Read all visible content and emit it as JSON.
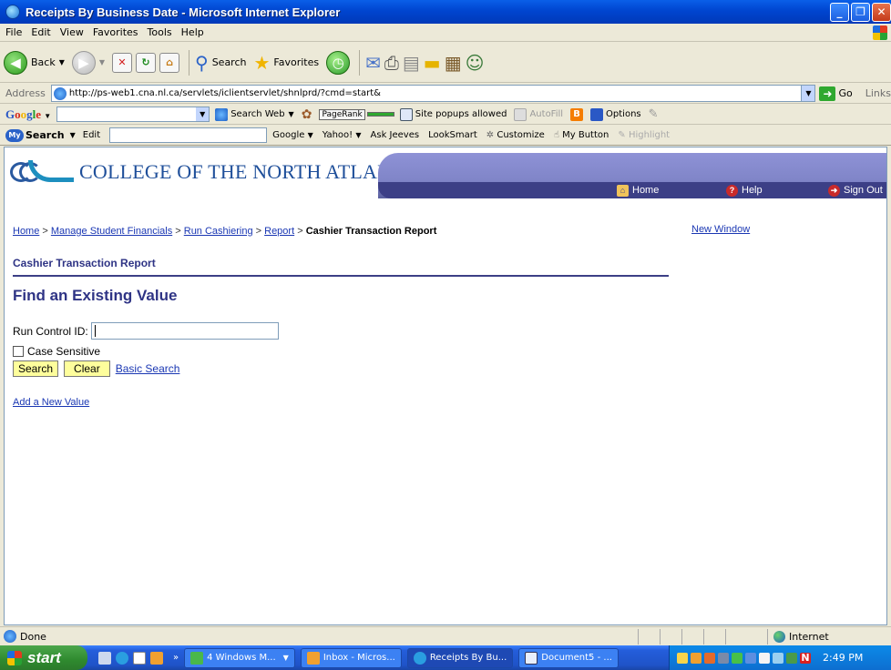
{
  "window": {
    "title": "Receipts By Business Date - Microsoft Internet Explorer",
    "min_glyph": "_",
    "max_glyph": "❐",
    "close_glyph": "✕"
  },
  "menu": [
    "File",
    "Edit",
    "View",
    "Favorites",
    "Tools",
    "Help"
  ],
  "toolbar": {
    "back_label": "Back",
    "search_label": "Search",
    "favorites_label": "Favorites"
  },
  "address": {
    "label": "Address",
    "url": "http://ps-web1.cna.nl.ca/servlets/iclientservlet/shnlprd/?cmd=start&",
    "go_label": "Go",
    "links_label": "Links"
  },
  "google_toolbar": {
    "logo": "Google",
    "search_web_label": "Search Web",
    "pagerank_label": "PageRank",
    "popups_label": "Site popups allowed",
    "autofill_label": "AutoFill",
    "options_label": "Options"
  },
  "mysearch_toolbar": {
    "logo_bubble": "My",
    "logo_label": "Search",
    "edit_label": "Edit",
    "items": [
      "Google",
      "Yahoo!",
      "Ask Jeeves",
      "LookSmart",
      "Customize",
      "My Button",
      "Highlight"
    ]
  },
  "page": {
    "brand": "COLLEGE OF THE NORTH ATLANTIC",
    "nav": {
      "home": "Home",
      "help": "Help",
      "signout": "Sign Out"
    },
    "breadcrumb": {
      "items": [
        "Home",
        "Manage Student Financials",
        "Run Cashiering",
        "Report"
      ],
      "separator": " > ",
      "current": "Cashier Transaction Report"
    },
    "new_window": "New Window",
    "title": "Cashier Transaction Report",
    "heading": "Find an Existing Value",
    "form": {
      "run_control_label": "Run Control ID:",
      "run_control_value": "",
      "case_sensitive_label": "Case Sensitive",
      "search_button": "Search",
      "clear_button": "Clear",
      "basic_search_link": "Basic Search",
      "add_new_link": "Add a New Value"
    }
  },
  "status": {
    "text": "Done",
    "zone": "Internet"
  },
  "taskbar": {
    "start_label": "start",
    "more": "»",
    "tasks": [
      "4 Windows M...",
      "Inbox - Micros...",
      "Receipts By Bu...",
      "Document5 - ..."
    ],
    "clock": "2:49 PM"
  }
}
